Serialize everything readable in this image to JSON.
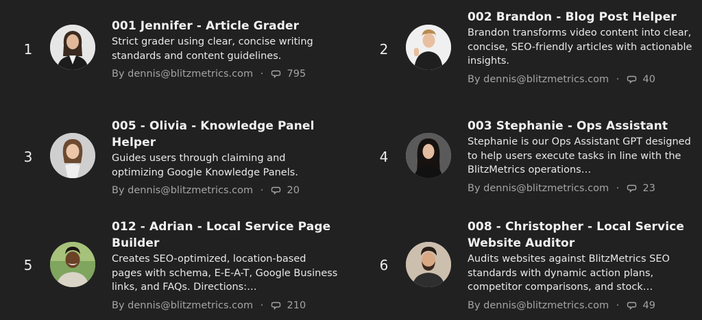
{
  "items": [
    {
      "rank": "1",
      "title": "001 Jennifer - Article Grader",
      "description": "Strict grader using clear, concise writing standards and content guidelines.",
      "author": "By dennis@blitzmetrics.com",
      "separator": "·",
      "count": "795",
      "avatar_icon": "woman-business-suit-avatar"
    },
    {
      "rank": "2",
      "title": "002 Brandon - Blog Post Helper",
      "description": "Brandon transforms video content into clear, concise, SEO-friendly articles with actionable insights.",
      "author": "By dennis@blitzmetrics.com",
      "separator": "·",
      "count": "40",
      "avatar_icon": "man-thumbs-up-avatar"
    },
    {
      "rank": "3",
      "title": "005 - Olivia - Knowledge Panel Helper",
      "description": "Guides users through claiming and optimizing Google Knowledge Panels.",
      "author": "By dennis@blitzmetrics.com",
      "separator": "·",
      "count": "20",
      "avatar_icon": "woman-smiling-avatar"
    },
    {
      "rank": "4",
      "title": "003 Stephanie - Ops Assistant",
      "description": "Stephanie is our Ops Assistant GPT designed to help users execute tasks in line with the BlitzMetrics operations…",
      "author": "By dennis@blitzmetrics.com",
      "separator": "·",
      "count": "23",
      "avatar_icon": "woman-dark-hair-avatar"
    },
    {
      "rank": "5",
      "title": "012 - Adrian - Local Service Page Builder",
      "description": "Creates SEO-optimized, location-based pages with schema, E-E-A-T, Google Business links, and FAQs. Directions:…",
      "author": "By dennis@blitzmetrics.com",
      "separator": "·",
      "count": "210",
      "avatar_icon": "man-smiling-outdoor-avatar"
    },
    {
      "rank": "6",
      "title": "008 - Christopher - Local Service Website Auditor",
      "description": "Audits websites against BlitzMetrics SEO standards with dynamic action plans, competitor comparisons, and stock…",
      "author": "By dennis@blitzmetrics.com",
      "separator": "·",
      "count": "49",
      "avatar_icon": "man-beard-avatar"
    }
  ],
  "colors": {
    "background": "#212121",
    "title": "#f2f2f2",
    "meta": "#a4a4a4"
  }
}
